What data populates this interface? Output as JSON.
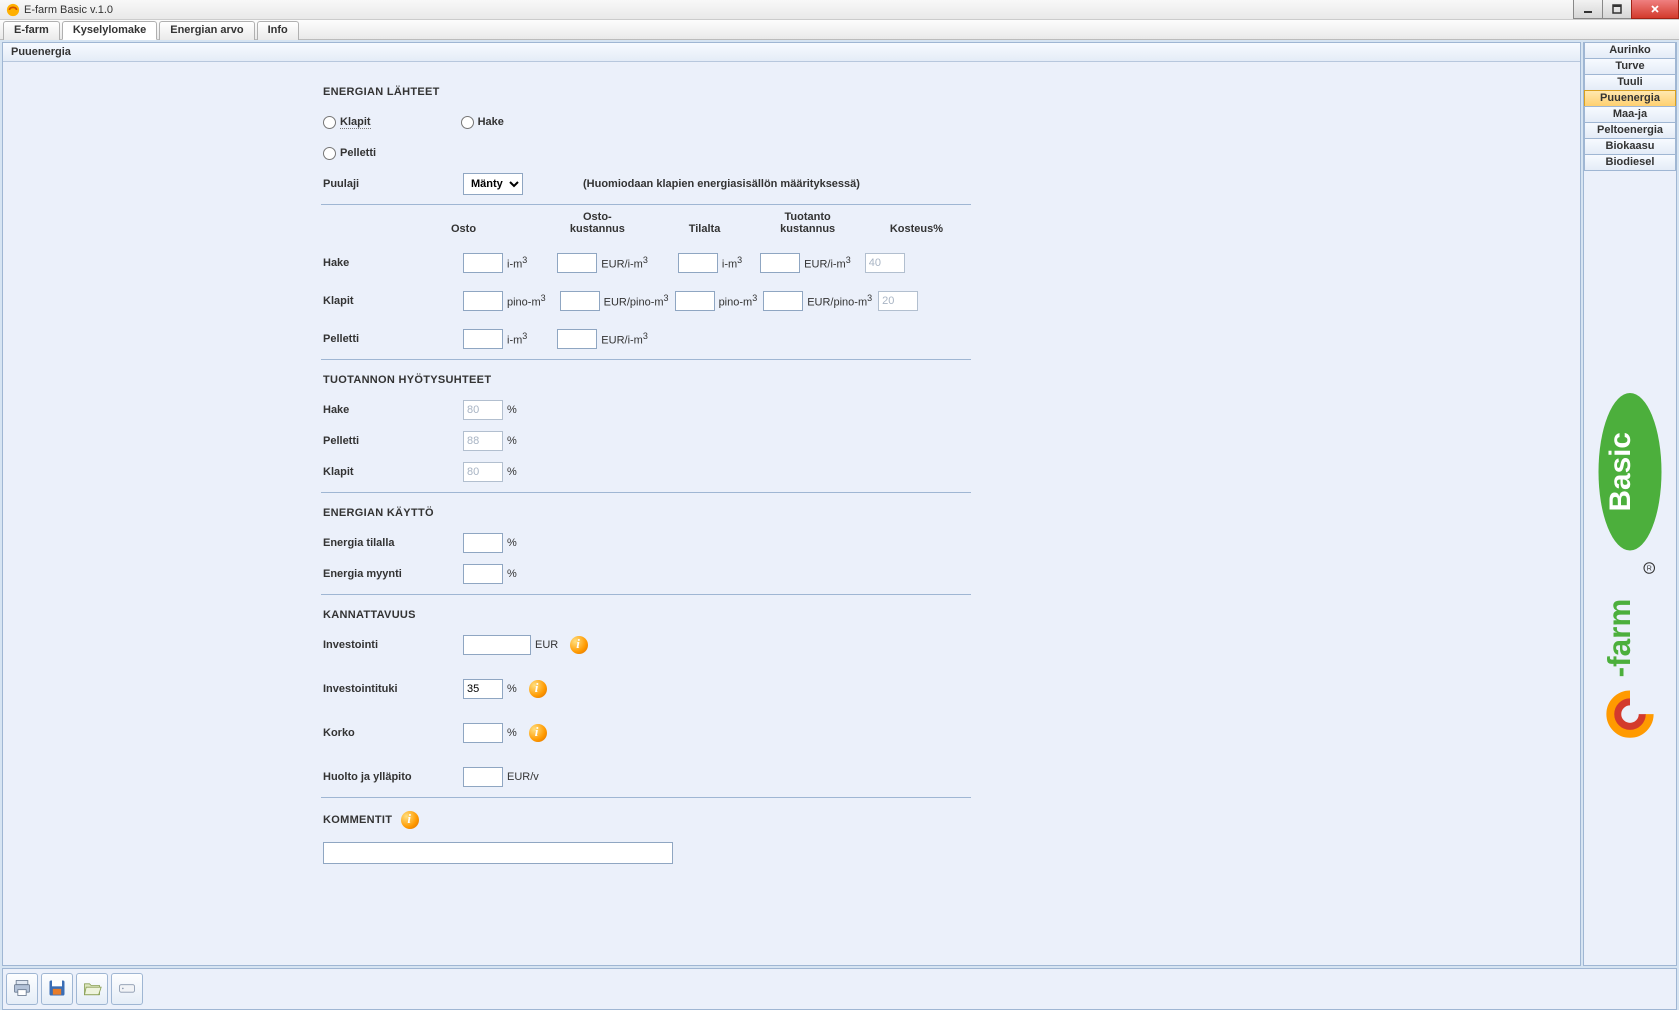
{
  "window": {
    "title": "E-farm Basic v.1.0"
  },
  "menubar": {
    "items": [
      "E-farm",
      "Kyselylomake",
      "Energian arvo",
      "Info"
    ],
    "activeIndex": 1
  },
  "panel": {
    "title": "Puuenergia"
  },
  "sidebar": {
    "items": [
      "Aurinko",
      "Turve",
      "Tuuli",
      "Puuenergia",
      "Maa-ja vesilämpö",
      "Peltoenergia",
      "Biokaasu",
      "Biodiesel"
    ],
    "selectedIndex": 3
  },
  "sections": {
    "sources_title": "ENERGIAN LÄHTEET",
    "radio": {
      "klapit": "Klapit",
      "hake": "Hake",
      "pelletti": "Pelletti"
    },
    "puulaji_label": "Puulaji",
    "puulaji_value": "Mänty",
    "puulaji_note": "(Huomiodaan klapien energiasisällön määrityksessä)",
    "col": {
      "osto": "Osto",
      "ostokust": "Osto-\nkustannus",
      "tilalta": "Tilalta",
      "tuotkust": "Tuotanto\nkustannus",
      "kosteus": "Kosteus%"
    },
    "rows": {
      "hake": {
        "label": "Hake",
        "u1": "i-m",
        "u2": "EUR/i-m",
        "u3": "i-m",
        "u4": "EUR/i-m",
        "kosteus": "40"
      },
      "klapit": {
        "label": "Klapit",
        "u1": "pino-m",
        "u2": "EUR/pino-m",
        "u3": "pino-m",
        "u4": "EUR/pino-m",
        "kosteus": "20"
      },
      "pelletti": {
        "label": "Pelletti",
        "u1": "i-m",
        "u2": "EUR/i-m"
      }
    },
    "eff_title": "TUOTANNON HYÖTYSUHTEET",
    "eff": {
      "hake": {
        "label": "Hake",
        "value": "80",
        "unit": "%"
      },
      "pelletti": {
        "label": "Pelletti",
        "value": "88",
        "unit": "%"
      },
      "klapit": {
        "label": "Klapit",
        "value": "80",
        "unit": "%"
      }
    },
    "use_title": "ENERGIAN KÄYTTÖ",
    "use": {
      "tilalla": {
        "label": "Energia tilalla",
        "unit": "%"
      },
      "myynti": {
        "label": "Energia myynti",
        "unit": "%"
      }
    },
    "prof_title": "KANNATTAVUUS",
    "prof": {
      "invest": {
        "label": "Investointi",
        "unit": "EUR"
      },
      "tuki": {
        "label": "Investointituki",
        "value": "35",
        "unit": "%"
      },
      "korko": {
        "label": "Korko",
        "unit": "%"
      },
      "huolto": {
        "label": "Huolto ja ylläpito",
        "unit": "EUR/v"
      }
    },
    "comments_title": "KOMMENTIT"
  }
}
